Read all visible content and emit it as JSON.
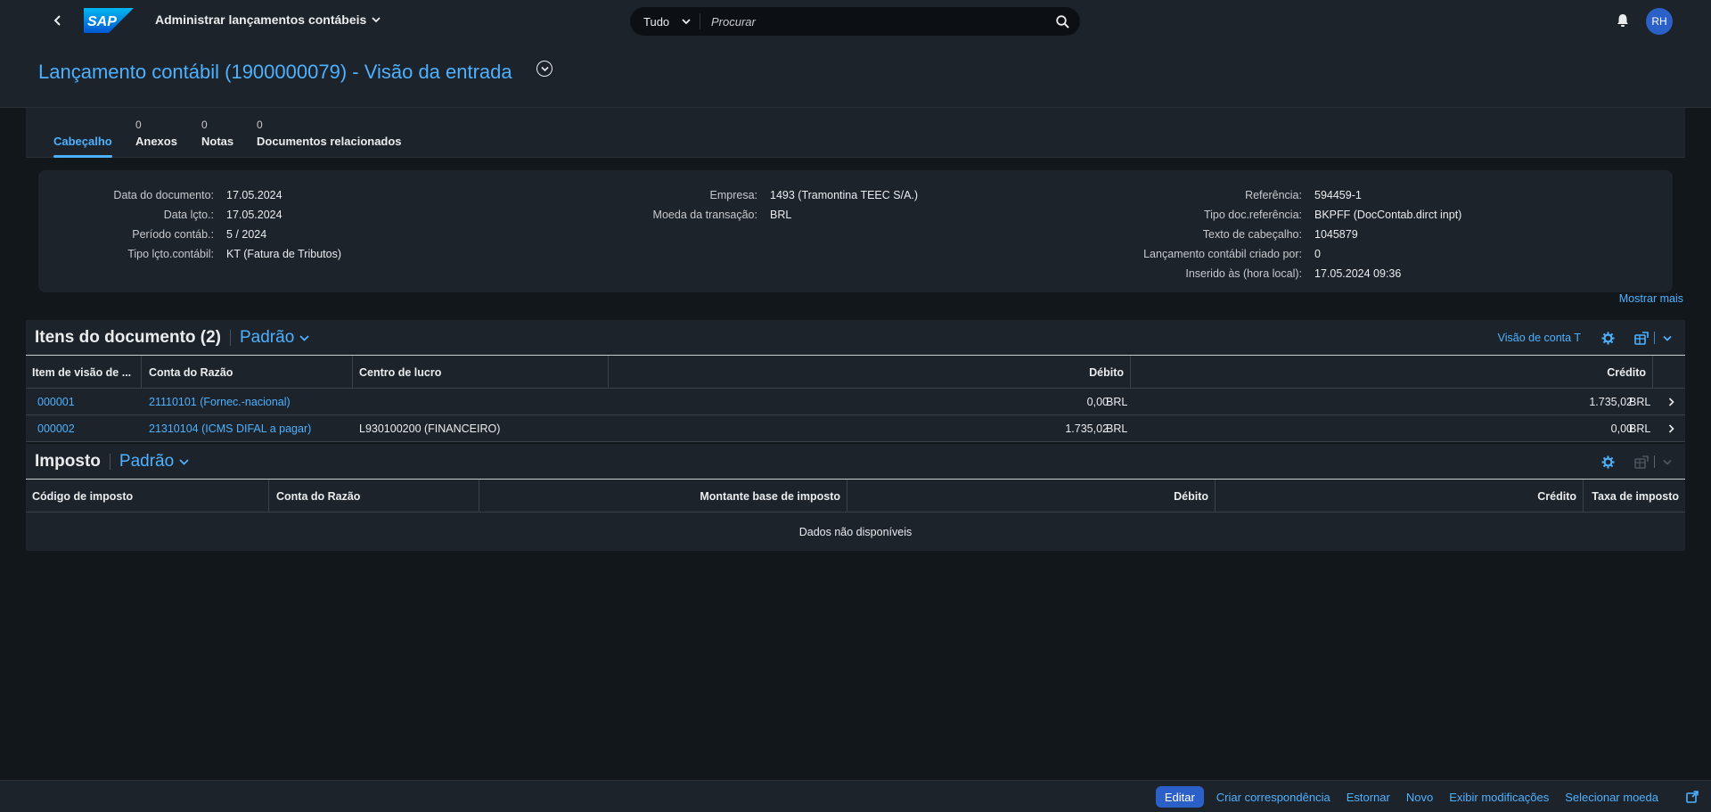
{
  "shell": {
    "app_title": "Administrar lançamentos contábeis",
    "search_scope": "Tudo",
    "search_placeholder": "Procurar",
    "user_initials": "RH"
  },
  "page": {
    "title": "Lançamento contábil (1900000079) - Visão da entrada"
  },
  "tabs": [
    {
      "label": "Cabeçalho",
      "count": ""
    },
    {
      "label": "Anexos",
      "count": "0"
    },
    {
      "label": "Notas",
      "count": "0"
    },
    {
      "label": "Documentos relacionados",
      "count": "0"
    }
  ],
  "header": {
    "col1": [
      {
        "label": "Data do documento:",
        "value": "17.05.2024"
      },
      {
        "label": "Data lçto.:",
        "value": "17.05.2024"
      },
      {
        "label": "Período contáb.:",
        "value": "5 / 2024"
      },
      {
        "label": "Tipo lçto.contábil:",
        "value": "KT (Fatura de Tributos)"
      }
    ],
    "col2": [
      {
        "label": "Empresa:",
        "value": "1493 (Tramontina TEEC S/A.)"
      },
      {
        "label": "Moeda da transação:",
        "value": "BRL"
      }
    ],
    "col3": [
      {
        "label": "Referência:",
        "value": "594459-1"
      },
      {
        "label": "Tipo doc.referência:",
        "value": "BKPFF (DocContab.dirct inpt)"
      },
      {
        "label": "Texto de cabeçalho:",
        "value": "1045879"
      },
      {
        "label": "Lançamento contábil criado por:",
        "value": "0"
      },
      {
        "label": "Inserido às (hora local):",
        "value": "17.05.2024 09:36"
      }
    ],
    "show_more": "Mostrar mais"
  },
  "items_table": {
    "title": "Itens do documento (2)",
    "variant": "Padrão",
    "t_account_link": "Visão de conta T",
    "columns": [
      "Item de visão de ...",
      "Conta do Razão",
      "Centro de lucro",
      "Débito",
      "Crédito"
    ],
    "rows": [
      {
        "item": "000001",
        "account": "21110101 (Fornec.-nacional)",
        "profit_center": "",
        "debit": "0,00",
        "debit_cur": "BRL",
        "credit": "1.735,02",
        "credit_cur": "BRL"
      },
      {
        "item": "000002",
        "account": "21310104 (ICMS DIFAL a pagar)",
        "profit_center": "L930100200 (FINANCEIRO)",
        "debit": "1.735,02",
        "debit_cur": "BRL",
        "credit": "0,00",
        "credit_cur": "BRL"
      }
    ]
  },
  "tax_table": {
    "title": "Imposto",
    "variant": "Padrão",
    "columns": [
      "Código de imposto",
      "Conta do Razão",
      "Montante base de imposto",
      "Débito",
      "Crédito",
      "Taxa de imposto"
    ],
    "no_data": "Dados não disponíveis"
  },
  "footer": {
    "buttons": [
      "Editar",
      "Criar correspondência",
      "Estornar",
      "Novo",
      "Exibir modificações",
      "Selecionar moeda"
    ]
  },
  "colors": {
    "background": "#12171c",
    "surface": "#1d232a",
    "link": "#4db1ff",
    "primary_button": "#2b60c9"
  }
}
